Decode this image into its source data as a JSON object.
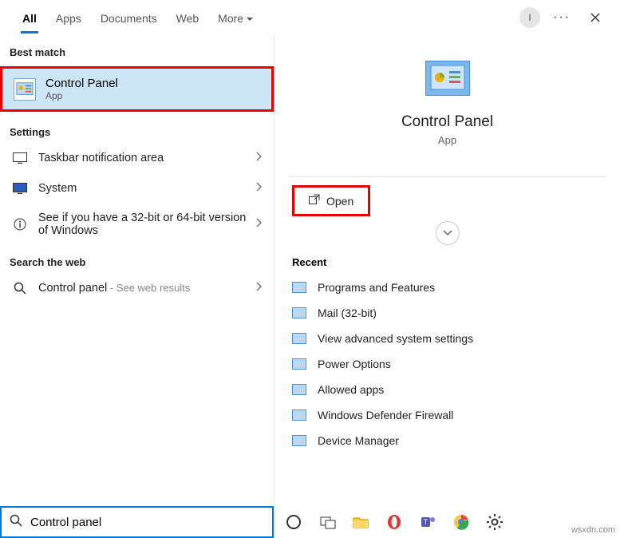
{
  "tabs": {
    "all": "All",
    "apps": "Apps",
    "documents": "Documents",
    "web": "Web",
    "more": "More"
  },
  "header": {
    "avatar_initial": "I"
  },
  "left": {
    "best_match_header": "Best match",
    "best": {
      "title": "Control Panel",
      "sub": "App"
    },
    "settings_header": "Settings",
    "settings": [
      {
        "label": "Taskbar notification area"
      },
      {
        "label": "System"
      },
      {
        "label": "See if you have a 32-bit or 64-bit version of Windows"
      }
    ],
    "web_header": "Search the web",
    "web": {
      "label": "Control panel",
      "hint": " - See web results"
    }
  },
  "detail": {
    "title": "Control Panel",
    "sub": "App",
    "open_label": "Open",
    "recent_header": "Recent",
    "recent": [
      "Programs and Features",
      "Mail (32-bit)",
      "View advanced system settings",
      "Power Options",
      "Allowed apps",
      "Windows Defender Firewall",
      "Device Manager"
    ]
  },
  "search": {
    "value": "Control panel"
  },
  "watermark": "wsxdn.com"
}
